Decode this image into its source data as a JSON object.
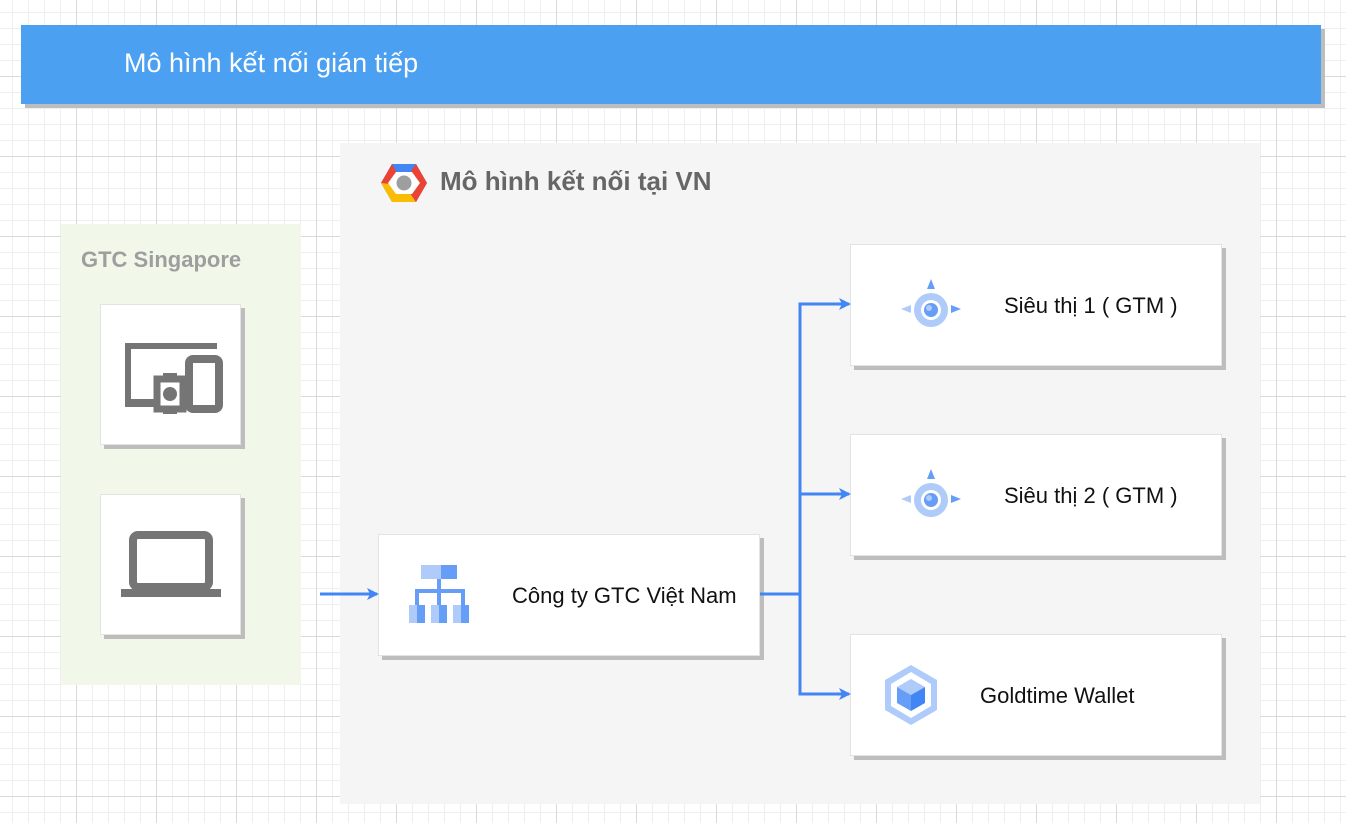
{
  "header": {
    "title": "Mô hình kết nối gián tiếp"
  },
  "vn_zone": {
    "title": "Mô hình kết nối tại VN",
    "logo_icon": "google-cloud-logo-icon"
  },
  "sg_zone": {
    "title": "GTC Singapore",
    "devices": [
      {
        "icon": "multiple-devices-icon"
      },
      {
        "icon": "laptop-icon"
      }
    ]
  },
  "nodes": {
    "company": {
      "label": "Công ty GTC Việt Nam",
      "icon": "network-hierarchy-icon"
    },
    "store1": {
      "label": "Siêu thị 1 ( GTM )",
      "icon": "compass-target-icon"
    },
    "store2": {
      "label": "Siêu thị 2 ( GTM )",
      "icon": "compass-target-icon"
    },
    "wallet": {
      "label": "Goldtime Wallet",
      "icon": "hexagon-cube-icon"
    }
  },
  "colors": {
    "header_bg": "#4ba0f2",
    "zone_vn_bg": "#f5f5f5",
    "zone_sg_bg": "#f1f8e9",
    "edge": "#4285f4",
    "icon_blue_light": "#aecbfa",
    "icon_blue": "#669df6",
    "icon_gray": "#757575"
  }
}
